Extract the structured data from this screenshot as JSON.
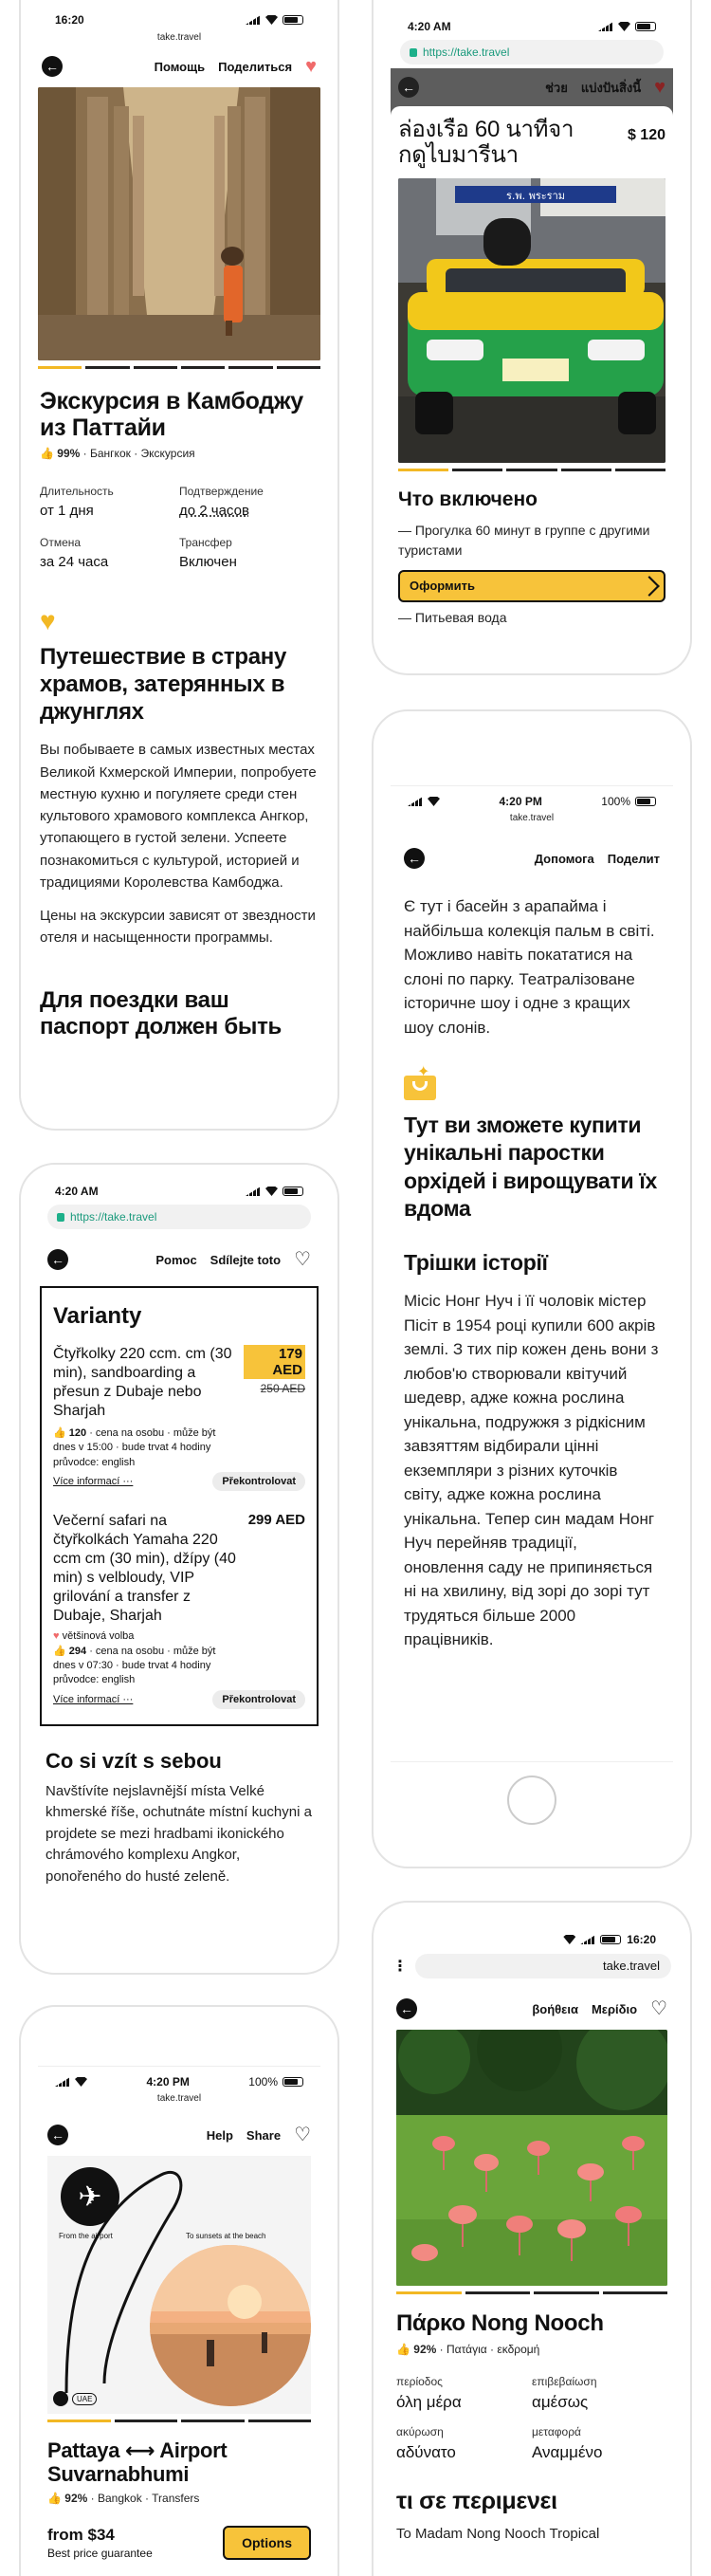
{
  "phone1": {
    "time": "16:20",
    "url": "take.travel",
    "nav_help": "Помощь",
    "nav_share": "Поделиться",
    "title": "Экскурсия в Камбоджу из Паттайи",
    "rating": "99%",
    "meta_rest": "· Бангкок · Экскурсия",
    "duration_label": "Длительность",
    "duration_value": "от 1 дня",
    "confirm_label": "Подтверждение",
    "confirm_value": "до 2 часов",
    "cancel_label": "Отмена",
    "cancel_value": "за 24 часа",
    "transfer_label": "Трансфер",
    "transfer_value": "Включен",
    "section_title": "Путешествие в страну храмов, затерянных в джунглях",
    "para1": "Вы побываете в самых известных местах Великой Кхмерской Империи, попробуете местную кухню и погуляете среди стен культового храмового комплекса Ангкор, утопающего в густой зелени. Успеете познакомиться с культурой, историей и традициями Королевства Камбоджа.",
    "para2": "Цены на экскурсии зависят от звездности отеля и насыщенности программы.",
    "cut_title": "Для поездки ваш паспорт должен быть"
  },
  "phone2": {
    "time": "4:20 AM",
    "url": "https://take.travel",
    "nav_help": "ช่วย",
    "nav_share": "แบ่งปันสิ่งนี้",
    "title": "ล่องเรือ 60 นาทีจากดูไบมารีนา",
    "price": "$ 120",
    "taxi_sign": "ร.พ. พระราม",
    "included_title": "Что включено",
    "included_item1": "— Прогулка 60 минут в группе с другими туристами",
    "cta": "Оформить",
    "included_item2": "— Питьевая вода"
  },
  "phone3": {
    "time": "4:20 PM",
    "battery": "100%",
    "url": "take.travel",
    "nav_help": "Допомога",
    "nav_share": "Поделит",
    "para1": "Є тут і басейн з арапайма і найбільша колекція пальм в світі. Можливо навіть покататися на слоні по парку. Театралізоване історичне шоу і одне з кращих шоу слонів.",
    "heading1": "Тут ви зможете купити унікальні паростки орхідей і вирощувати їх вдома",
    "heading2": "Трішки історії",
    "para2": "Місіс Нонг Нуч і її чоловік містер Пісіт в 1954 році купили 600 акрів землі. З тих пір кожен день вони з любов'ю створювали квітучий шедевр, адже кожна рослина унікальна, подружжя з рідкісним завзяттям відбирали цінні екземпляри з різних куточків світу, адже кожна рослина унікальна. Тепер син мадам Нонг Нуч перейняв традиції, оновлення саду не припиняється ні на хвилину, від зорі до зорі тут трудяться більше 2000 працівників."
  },
  "phone4": {
    "time": "4:20 AM",
    "url": "https://take.travel",
    "nav_help": "Pomoc",
    "nav_share": "Sdílejte toto",
    "variants_title": "Varianty",
    "v1_title": "Čtyřkolky 220 ccm. cm (30 min),  sandboarding a přesun z Dubaje nebo Sharjah",
    "v1_price": "179 AED",
    "v1_old_price": "250 AED",
    "v1_count": "120",
    "v1_line1": "· cena na osobu · může být",
    "v1_line2": "dnes v 15:00 · bude trvat 4 hodiny",
    "v1_line3": "průvodce: english",
    "v1_more": "Více informací ···",
    "v1_check": "Překontrolovat",
    "v2_title": "Večerní safari na čtyřkolkách Yamaha 220 ccm cm (30 min), džípy (40 min) s velbloudy, VIP grilování a transfer z Dubaje, Sharjah",
    "v2_price": "299 AED",
    "v2_badge": "většinová volba",
    "v2_count": "294",
    "v2_line1": "· cena na osobu · může být",
    "v2_line2": "dnes v 07:30 · bude trvat 4 hodiny",
    "v2_line3": "průvodce: english",
    "v2_more": "Více informací ···",
    "v2_check": "Překontrolovat",
    "bring_title": "Co si vzít s sebou",
    "bring_text": "Navštívíte nejslavnější místa Velké khmerské říše, ochutnáte místní kuchyni a projdete se mezi hradbami ikonického chrámového komplexu Angkor, ponořeného do husté zeleně."
  },
  "phone5": {
    "time": "16:20",
    "url": "take.travel",
    "nav_help": "βοήθεια",
    "nav_share": "Μερίδιο",
    "title": "Πάρκο Nong Nooch",
    "rating": "92%",
    "meta_rest": "· Πατάγια · εκδρομή",
    "duration_label": "περίοδος",
    "duration_value": "όλη μέρα",
    "confirm_label": "επιβεβαίωση",
    "confirm_value": "αμέσως",
    "cancel_label": "ακύρωση",
    "cancel_value": "αδύνατο",
    "transfer_label": "μεταφορά",
    "transfer_value": "Αναμμένο",
    "section_title": "τι σε περιμενει",
    "cut_text": "To Madam Nong Nooch Tropical"
  },
  "phone6": {
    "time": "4:20 PM",
    "battery": "100%",
    "url": "take.travel",
    "nav_help": "Help",
    "nav_share": "Share",
    "from_airport": "From the airport",
    "to_sunsets": "To sunsets at the beach",
    "uae_badge": "UAE",
    "title": "Pattaya ⟷ Airport Suvarnabhumi",
    "rating": "92%",
    "meta_rest": "· Bangkok · Transfers",
    "price": "from $34",
    "price_note": "Best price guarantee",
    "options": "Options"
  },
  "colors": {
    "accent_yellow": "#f7c33a",
    "heart_red": "#f06a6a",
    "link_green": "#1a9a7c"
  }
}
